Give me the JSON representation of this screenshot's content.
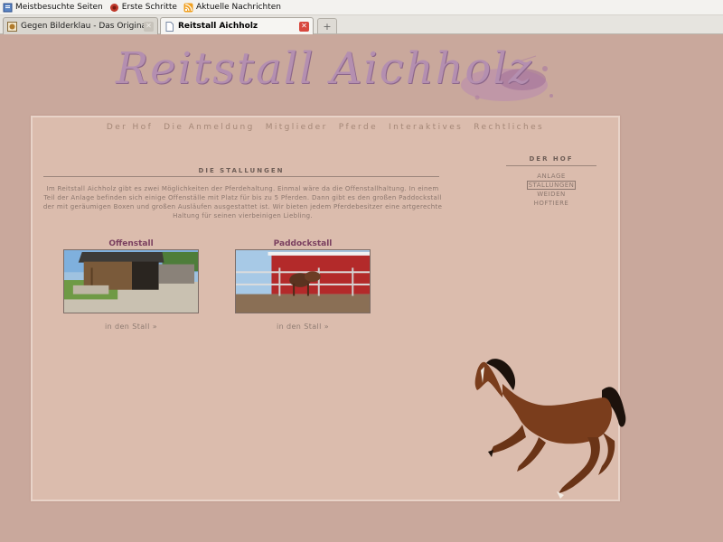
{
  "browser": {
    "bookmarks": [
      {
        "label": "Meistbesuchte Seiten",
        "icon": "bookmark-page-icon"
      },
      {
        "label": "Erste Schritte",
        "icon": "firefox-icon"
      },
      {
        "label": "Aktuelle Nachrichten",
        "icon": "rss-feed-icon"
      }
    ],
    "tabs": [
      {
        "label": "Gegen Bilderklau - Das Original | Bewer...",
        "active": false
      },
      {
        "label": "Reitstall Aichholz",
        "active": true
      }
    ],
    "new_tab_symbol": "+"
  },
  "site": {
    "logo_text": "Reitstall Aichholz",
    "nav": [
      "Der Hof",
      "Die Anmeldung",
      "Mitglieder",
      "Pferde",
      "Interaktives",
      "Rechtliches"
    ],
    "heading": "DIE STALLUNGEN",
    "intro": "Im Reitstall Aichholz gibt es zwei Möglichkeiten der Pferdehaltung. Einmal wäre da die Offenstallhaltung. In einem Teil der Anlage befinden sich einige Offenställe mit Platz für bis zu 5 Pferden. Dann gibt es den großen Paddockstall der mit geräumigen Boxen und großen Ausläufen ausgestattet ist. Wir bieten jedem Pferdebesitzer eine artgerechte Haltung für seinen vierbeinigen Liebling.",
    "stalls": [
      {
        "title": "Offenstall",
        "link": "in den Stall »"
      },
      {
        "title": "Paddockstall",
        "link": "in den Stall »"
      }
    ],
    "sidebar": {
      "heading": "DER HOF",
      "items": [
        "ANLAGE",
        "STALLUNGEN",
        "WEIDEN",
        "HOFTIERE"
      ],
      "current_index": 1
    }
  },
  "colors": {
    "page_background": "#c9a89c",
    "content_background": "#dbbcad",
    "accent": "#7a3f5f"
  }
}
